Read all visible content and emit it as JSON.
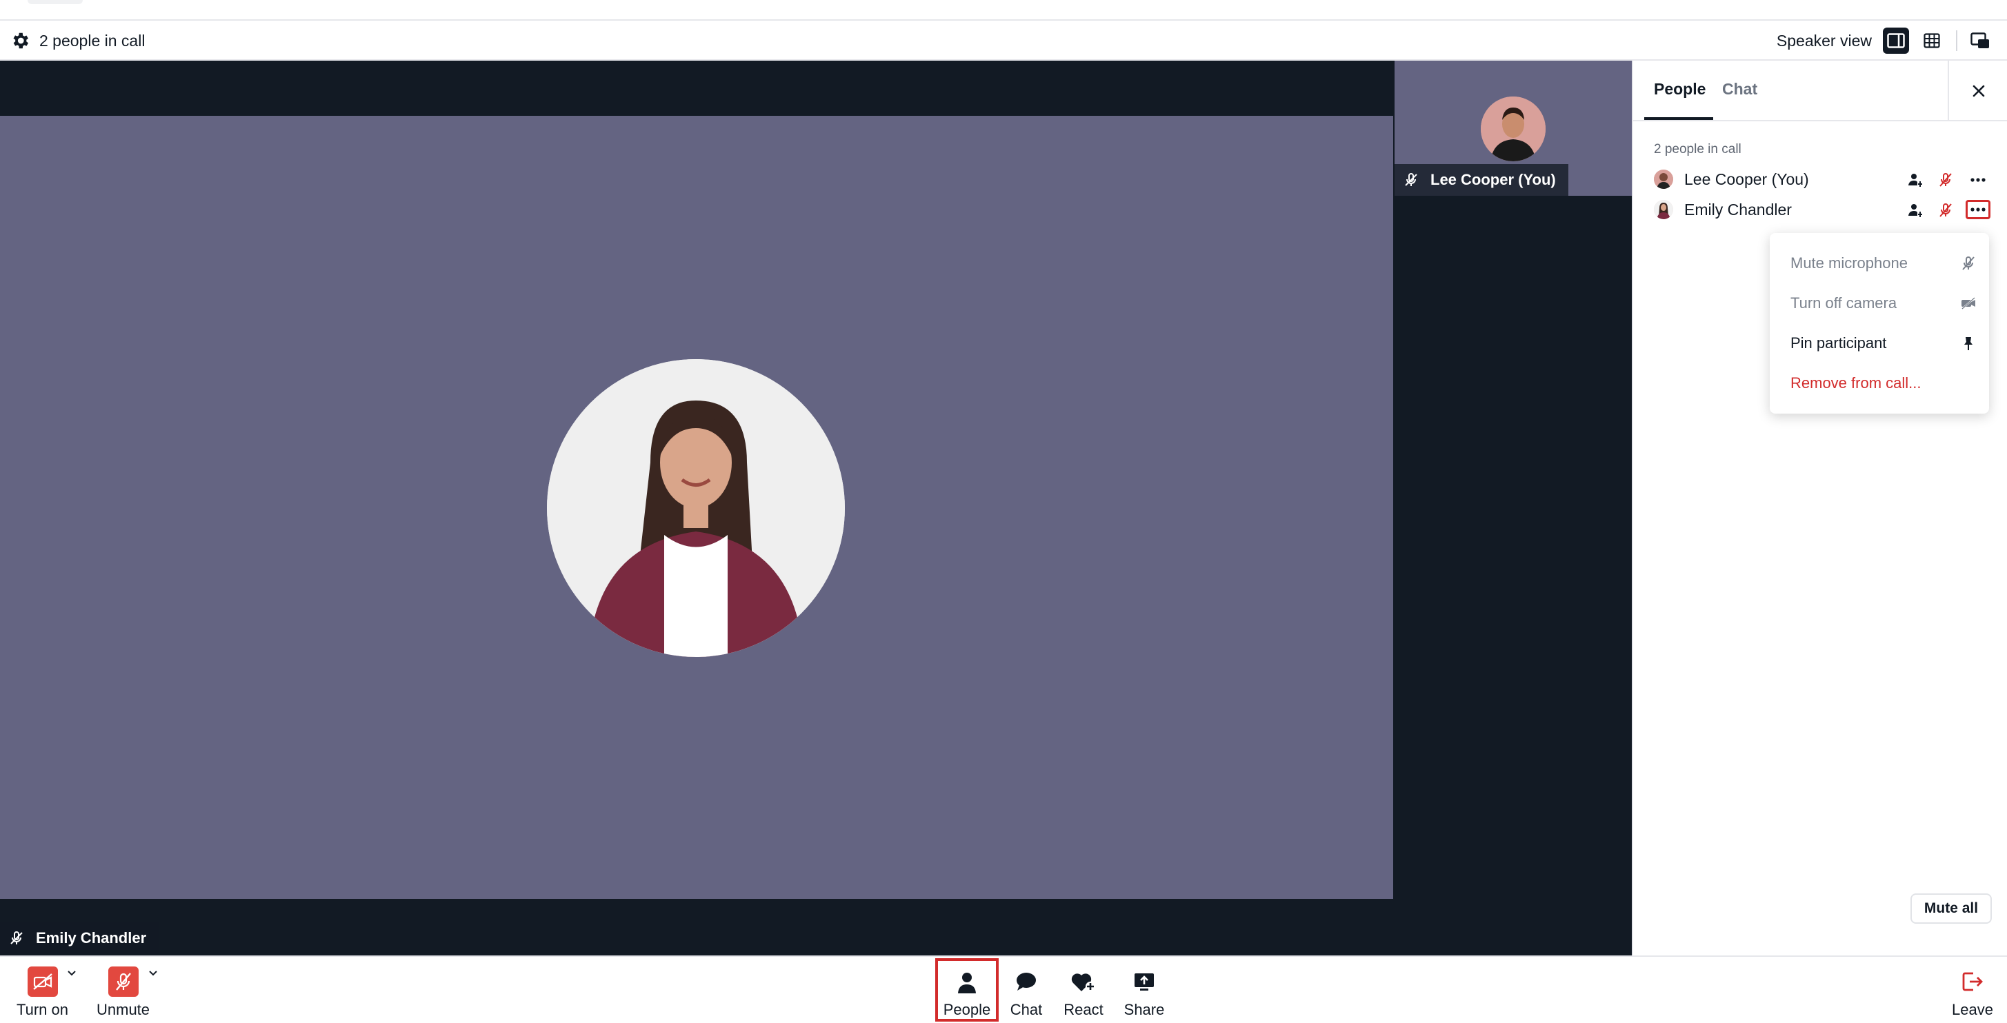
{
  "infobar": {
    "people_count": "2 people in call",
    "view_label": "Speaker view"
  },
  "stage": {
    "main_participant": "Emily Chandler",
    "side_participant": "Lee Cooper (You)"
  },
  "panel": {
    "tabs": [
      {
        "label": "People",
        "active": true
      },
      {
        "label": "Chat",
        "active": false
      }
    ],
    "count_label": "2 people in call",
    "participants": [
      {
        "name": "Lee Cooper (You)"
      },
      {
        "name": "Emily Chandler"
      }
    ],
    "menu": [
      {
        "label": "Mute microphone",
        "icon": "mic-off-icon",
        "state": "disabled"
      },
      {
        "label": "Turn off camera",
        "icon": "camera-off-icon",
        "state": "disabled"
      },
      {
        "label": "Pin participant",
        "icon": "pin-icon",
        "state": "normal"
      },
      {
        "label": "Remove from call...",
        "icon": "",
        "state": "danger"
      }
    ],
    "mute_all_label": "Mute all"
  },
  "toolbar": {
    "camera_label": "Turn on",
    "mic_label": "Unmute",
    "people_label": "People",
    "chat_label": "Chat",
    "react_label": "React",
    "share_label": "Share",
    "leave_label": "Leave"
  },
  "colors": {
    "stage_bg": "#121a24",
    "tile_bg": "#646482",
    "danger": "#d22b2b",
    "media_off": "#e2483f"
  }
}
